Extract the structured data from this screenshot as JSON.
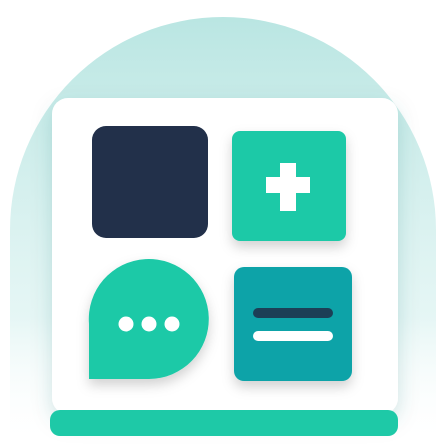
{
  "illustration": {
    "icons": [
      "grid-square-icon",
      "plus-icon",
      "chat-bubble-icon",
      "equals-icon"
    ],
    "colors": {
      "halo": "#b9e6e3",
      "card": "#ffffff",
      "navy": "#22304a",
      "mint": "#1ec9a7",
      "teal": "#0aa3a8",
      "bar": "#1ec9a7",
      "dark_line": "#1c3f56",
      "white": "#ffffff"
    }
  }
}
